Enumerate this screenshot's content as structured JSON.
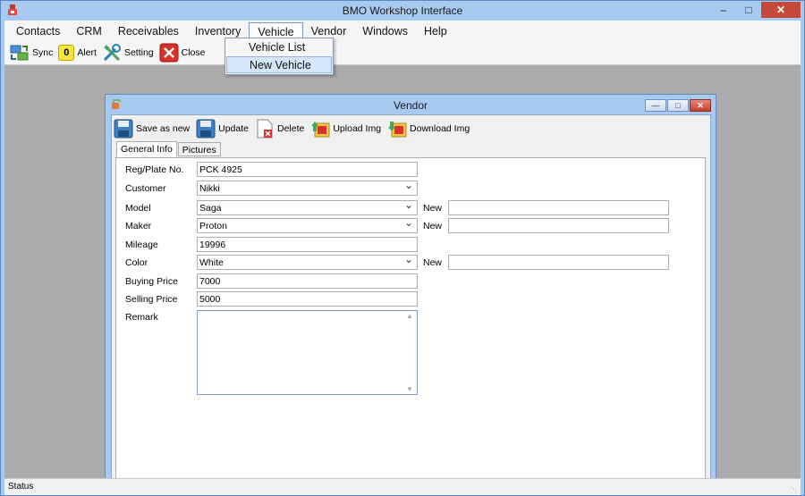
{
  "app": {
    "title": "BMO Workshop Interface"
  },
  "menubar": {
    "items": [
      "Contacts",
      "CRM",
      "Receivables",
      "Inventory",
      "Vehicle",
      "Vendor",
      "Windows",
      "Help"
    ],
    "open_menu": "Vehicle"
  },
  "vehicle_menu": {
    "items": [
      "Vehicle List",
      "New Vehicle"
    ],
    "highlighted": "New Vehicle"
  },
  "main_toolbar": {
    "sync": "Sync",
    "alert_count": "0",
    "alert": "Alert",
    "setting": "Setting",
    "close": "Close"
  },
  "child_window": {
    "title": "Vendor",
    "toolbar": {
      "save_as_new": "Save as new",
      "update": "Update",
      "delete": "Delete",
      "upload_img": "Upload Img",
      "download_img": "Download Img"
    },
    "tabs": [
      "General Info",
      "Pictures"
    ],
    "active_tab": "General Info"
  },
  "form": {
    "reg_plate_label": "Reg/Plate No.",
    "reg_plate_value": "PCK 4925",
    "customer_label": "Customer",
    "customer_value": "Nikki",
    "model_label": "Model",
    "model_value": "Saga",
    "maker_label": "Maker",
    "maker_value": "Proton",
    "mileage_label": "Mileage",
    "mileage_value": "19996",
    "color_label": "Color",
    "color_value": "White",
    "buying_price_label": "Buying Price",
    "buying_price_value": "7000",
    "selling_price_label": "Selling Price",
    "selling_price_value": "5000",
    "remark_label": "Remark",
    "remark_value": "",
    "new_label": "New"
  },
  "status": {
    "text": "Status"
  },
  "colors": {
    "titlebar": "#a9caf0",
    "close_red": "#c7493a",
    "mdi_background": "#ababab",
    "highlight": "#d5e6f8"
  }
}
